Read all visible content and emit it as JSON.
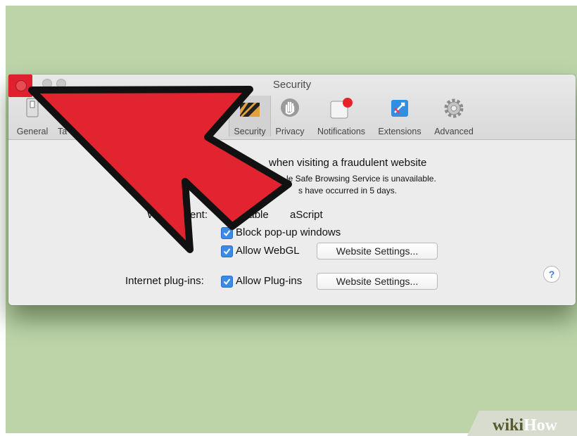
{
  "window": {
    "title": "Security"
  },
  "toolbar": {
    "items": [
      {
        "label": "General",
        "icon": "switch-icon"
      },
      {
        "label": "Ta",
        "icon": "tabs-icon"
      },
      {
        "label": "Security",
        "icon": "security-icon",
        "selected": true
      },
      {
        "label": "Privacy",
        "icon": "hand-icon"
      },
      {
        "label": "Notifications",
        "icon": "notification-icon"
      },
      {
        "label": "Extensions",
        "icon": "puzzle-icon"
      },
      {
        "label": "Advanced",
        "icon": "gear-icon"
      }
    ]
  },
  "security": {
    "fraud_warning": "when visiting a fraudulent website",
    "fraud_note_1": "le Safe Browsing Service is unavailable.",
    "fraud_note_2": "s have occurred in 5 days.",
    "web_content_label": "W",
    "web_content_label_tail": "ent:",
    "enable_js": "Enable ",
    "enable_js_tail": "aScript",
    "block_popups": "Block pop-up windows",
    "allow_webgl": "Allow WebGL",
    "website_settings_1": "Website Settings...",
    "plugins_label": "Internet plug-ins:",
    "allow_plugins": "Allow Plug-ins",
    "website_settings_2": "Website Settings...",
    "help": "?"
  },
  "colors": {
    "backdrop": "#bcd4a8",
    "arrow_fill": "#e1242f",
    "checkbox": "#3b8ae8",
    "highlight": "#e0202e"
  },
  "watermark": {
    "wiki": "wiki",
    "how": "How"
  }
}
